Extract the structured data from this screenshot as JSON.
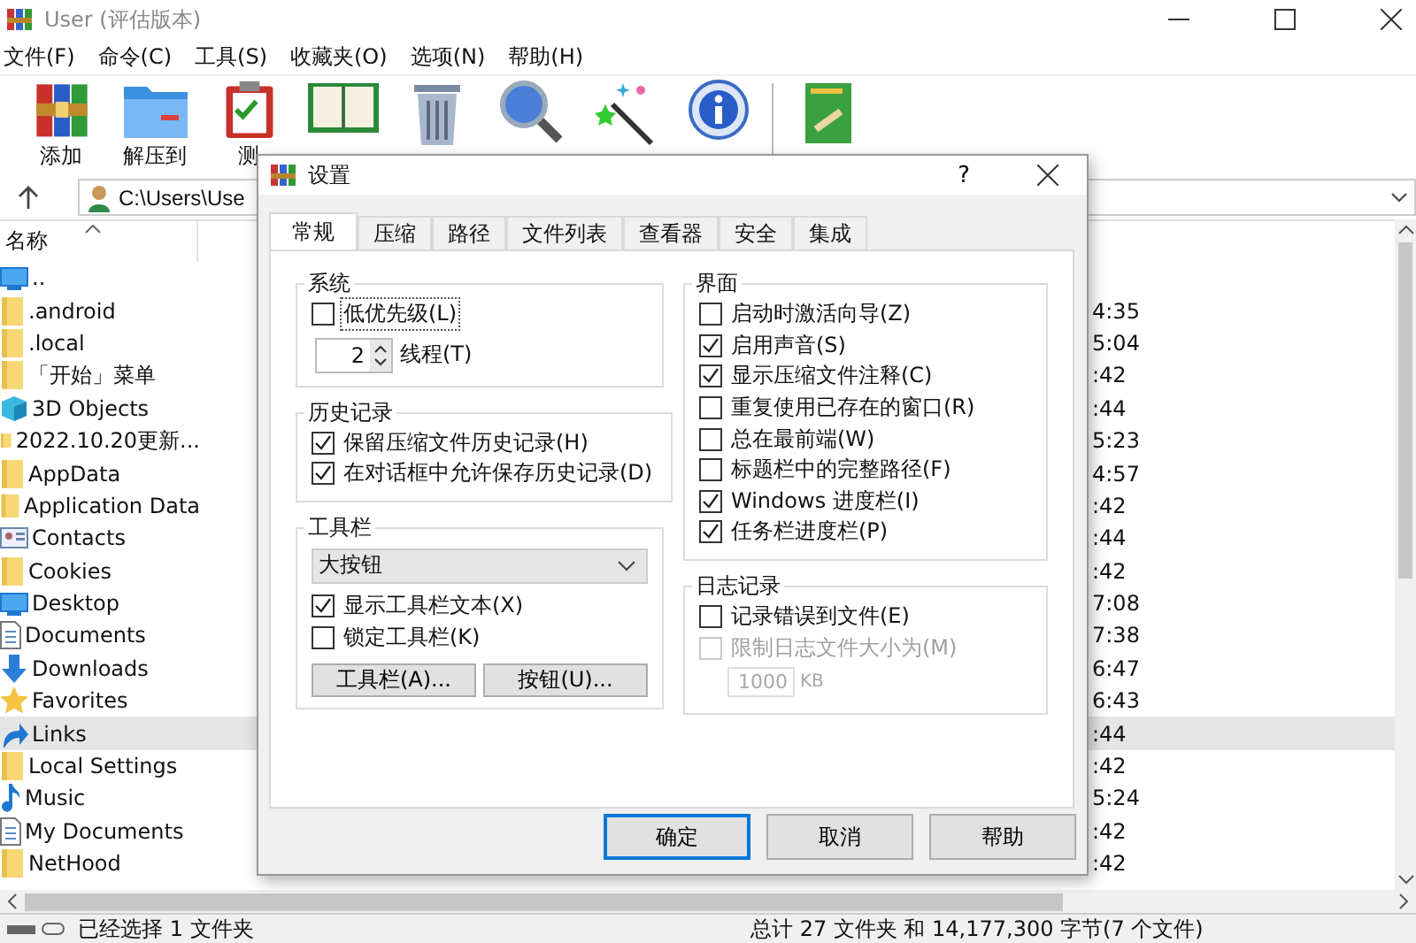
{
  "window": {
    "title": "User (评估版本)"
  },
  "menu": [
    "文件(F)",
    "命令(C)",
    "工具(S)",
    "收藏夹(O)",
    "选项(N)",
    "帮助(H)"
  ],
  "toolbar": {
    "labels": [
      "添加",
      "解压到",
      "测"
    ]
  },
  "address": {
    "path": "C:\\Users\\Use"
  },
  "file_list": {
    "column": "名称",
    "rows": [
      {
        "kind": "parent",
        "name": "..",
        "selected": false
      },
      {
        "kind": "folder",
        "name": ".android",
        "time": "4:35",
        "selected": false
      },
      {
        "kind": "folder",
        "name": ".local",
        "time": "5:04",
        "selected": false
      },
      {
        "kind": "folder",
        "name": "「开始」菜单",
        "time": ":42",
        "selected": false
      },
      {
        "kind": "cube",
        "name": "3D Objects",
        "time": ":44",
        "selected": false
      },
      {
        "kind": "folder",
        "name": "2022.10.20更新...",
        "time": "5:23",
        "selected": false
      },
      {
        "kind": "folder",
        "name": "AppData",
        "time": "4:57",
        "selected": false
      },
      {
        "kind": "folder",
        "name": "Application Data",
        "time": ":42",
        "selected": false
      },
      {
        "kind": "contacts",
        "name": "Contacts",
        "time": ":44",
        "selected": false
      },
      {
        "kind": "folder",
        "name": "Cookies",
        "time": ":42",
        "selected": false
      },
      {
        "kind": "desktop",
        "name": "Desktop",
        "time": "7:08",
        "selected": false
      },
      {
        "kind": "document",
        "name": "Documents",
        "time": "7:38",
        "selected": false
      },
      {
        "kind": "download",
        "name": "Downloads",
        "time": "6:47",
        "selected": false
      },
      {
        "kind": "star",
        "name": "Favorites",
        "time": "6:43",
        "selected": false
      },
      {
        "kind": "link",
        "name": "Links",
        "time": ":44",
        "selected": true
      },
      {
        "kind": "folder",
        "name": "Local Settings",
        "time": ":42",
        "selected": false
      },
      {
        "kind": "music",
        "name": "Music",
        "time": "5:24",
        "selected": false
      },
      {
        "kind": "document",
        "name": "My Documents",
        "time": ":42",
        "selected": false
      },
      {
        "kind": "folder",
        "name": "NetHood",
        "time": ":42",
        "selected": false
      }
    ]
  },
  "status_bar": {
    "selection": "已经选择 1 文件夹",
    "total": "总计 27 文件夹 和 14,177,300 字节(7 个文件)"
  },
  "dialog": {
    "title": "设置",
    "help": "?",
    "tabs": [
      {
        "label": "常规",
        "selected": true
      },
      {
        "label": "压缩",
        "selected": false
      },
      {
        "label": "路径",
        "selected": false
      },
      {
        "label": "文件列表",
        "selected": false
      },
      {
        "label": "查看器",
        "selected": false
      },
      {
        "label": "安全",
        "selected": false
      },
      {
        "label": "集成",
        "selected": false
      }
    ],
    "left_groups": [
      {
        "title": "系统",
        "items": [
          {
            "kind": "checkbox",
            "label": "低优先级(L)",
            "checked": false,
            "disabled": false,
            "focused": true
          },
          {
            "kind": "spinner",
            "value": "2",
            "label": "线程(T)"
          }
        ]
      },
      {
        "title": "历史记录",
        "items": [
          {
            "kind": "checkbox",
            "label": "保留压缩文件历史记录(H)",
            "checked": true,
            "disabled": false,
            "focused": false
          },
          {
            "kind": "checkbox",
            "label": "在对话框中允许保存历史记录(D)",
            "checked": true,
            "disabled": false,
            "focused": false
          }
        ]
      },
      {
        "title": "工具栏",
        "items": [
          {
            "kind": "dropdown",
            "value": "大按钮"
          },
          {
            "kind": "checkbox",
            "label": "显示工具栏文本(X)",
            "checked": true,
            "disabled": false,
            "focused": false
          },
          {
            "kind": "checkbox",
            "label": "锁定工具栏(K)",
            "checked": false,
            "disabled": false,
            "focused": false
          },
          {
            "kind": "buttons",
            "labels": [
              "工具栏(A)...",
              "按钮(U)..."
            ]
          }
        ]
      }
    ],
    "right_groups": [
      {
        "title": "界面",
        "items": [
          {
            "kind": "checkbox",
            "label": "启动时激活向导(Z)",
            "checked": false,
            "disabled": false,
            "focused": false
          },
          {
            "kind": "checkbox",
            "label": "启用声音(S)",
            "checked": true,
            "disabled": false,
            "focused": false
          },
          {
            "kind": "checkbox",
            "label": "显示压缩文件注释(C)",
            "checked": true,
            "disabled": false,
            "focused": false
          },
          {
            "kind": "checkbox",
            "label": "重复使用已存在的窗口(R)",
            "checked": false,
            "disabled": false,
            "focused": false
          },
          {
            "kind": "checkbox",
            "label": "总在最前端(W)",
            "checked": false,
            "disabled": false,
            "focused": false
          },
          {
            "kind": "checkbox",
            "label": "标题栏中的完整路径(F)",
            "checked": false,
            "disabled": false,
            "focused": false
          },
          {
            "kind": "checkbox",
            "label": "Windows 进度栏(I)",
            "checked": true,
            "disabled": false,
            "focused": false
          },
          {
            "kind": "checkbox",
            "label": "任务栏进度栏(P)",
            "checked": true,
            "disabled": false,
            "focused": false
          }
        ]
      },
      {
        "title": "日志记录",
        "items": [
          {
            "kind": "checkbox",
            "label": "记录错误到文件(E)",
            "checked": false,
            "disabled": false,
            "focused": false
          },
          {
            "kind": "checkbox",
            "label": "限制日志文件大小为(M)",
            "checked": false,
            "disabled": true,
            "focused": false
          },
          {
            "kind": "size",
            "value": "1000",
            "unit": "KB",
            "disabled": true
          }
        ]
      }
    ],
    "buttons": [
      {
        "label": "确定",
        "default": true
      },
      {
        "label": "取消",
        "default": false
      },
      {
        "label": "帮助",
        "default": false
      }
    ]
  }
}
